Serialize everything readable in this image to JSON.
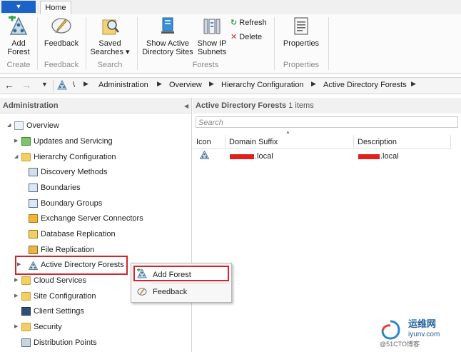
{
  "ribbon": {
    "tabs": [
      "Home"
    ],
    "groups": [
      {
        "label": "Create",
        "buttons": [
          {
            "label_line1": "Add",
            "label_line2": "Forest"
          }
        ]
      },
      {
        "label": "Feedback",
        "buttons": [
          {
            "label_line1": "Feedback",
            "label_line2": ""
          }
        ]
      },
      {
        "label": "Search",
        "buttons": [
          {
            "label_line1": "Saved",
            "label_line2": "Searches ▾"
          }
        ]
      },
      {
        "label": "Forests",
        "buttons": [
          {
            "label_line1": "Show Active",
            "label_line2": "Directory Sites"
          },
          {
            "label_line1": "Show IP",
            "label_line2": "Subnets"
          }
        ],
        "small_buttons": [
          "Refresh",
          "Delete"
        ]
      },
      {
        "label": "Properties",
        "buttons": [
          {
            "label_line1": "Properties",
            "label_line2": ""
          }
        ]
      }
    ]
  },
  "address_bar": {
    "crumbs": [
      "\\",
      "Administration",
      "Overview",
      "Hierarchy Configuration",
      "Active Directory Forests"
    ]
  },
  "left_pane": {
    "title": "Administration",
    "tree": [
      {
        "label": "Overview"
      },
      {
        "label": "Updates and Servicing"
      },
      {
        "label": "Hierarchy Configuration"
      },
      {
        "label": "Discovery Methods"
      },
      {
        "label": "Boundaries"
      },
      {
        "label": "Boundary Groups"
      },
      {
        "label": "Exchange Server Connectors"
      },
      {
        "label": "Database Replication"
      },
      {
        "label": "File Replication"
      },
      {
        "label": "Active Directory Forests"
      },
      {
        "label": "Cloud Services"
      },
      {
        "label": "Site Configuration"
      },
      {
        "label": "Client Settings"
      },
      {
        "label": "Security"
      },
      {
        "label": "Distribution Points"
      }
    ]
  },
  "right_pane": {
    "title": "Active Directory Forests",
    "count": "1 items",
    "search_placeholder": "Search",
    "columns": [
      "Icon",
      "Domain Suffix",
      "Description"
    ],
    "rows": [
      {
        "domain_suffix": ".local",
        "description": ".local"
      }
    ]
  },
  "context_menu": {
    "items": [
      "Add Forest",
      "Feedback"
    ]
  },
  "watermark": {
    "line1": "运维网",
    "line2": "iyunv.com",
    "line3": "@51CTO博客"
  },
  "colors": {
    "highlight": "#d4232b",
    "file_tab": "#1b63c9",
    "folder": "#f3cf63"
  }
}
